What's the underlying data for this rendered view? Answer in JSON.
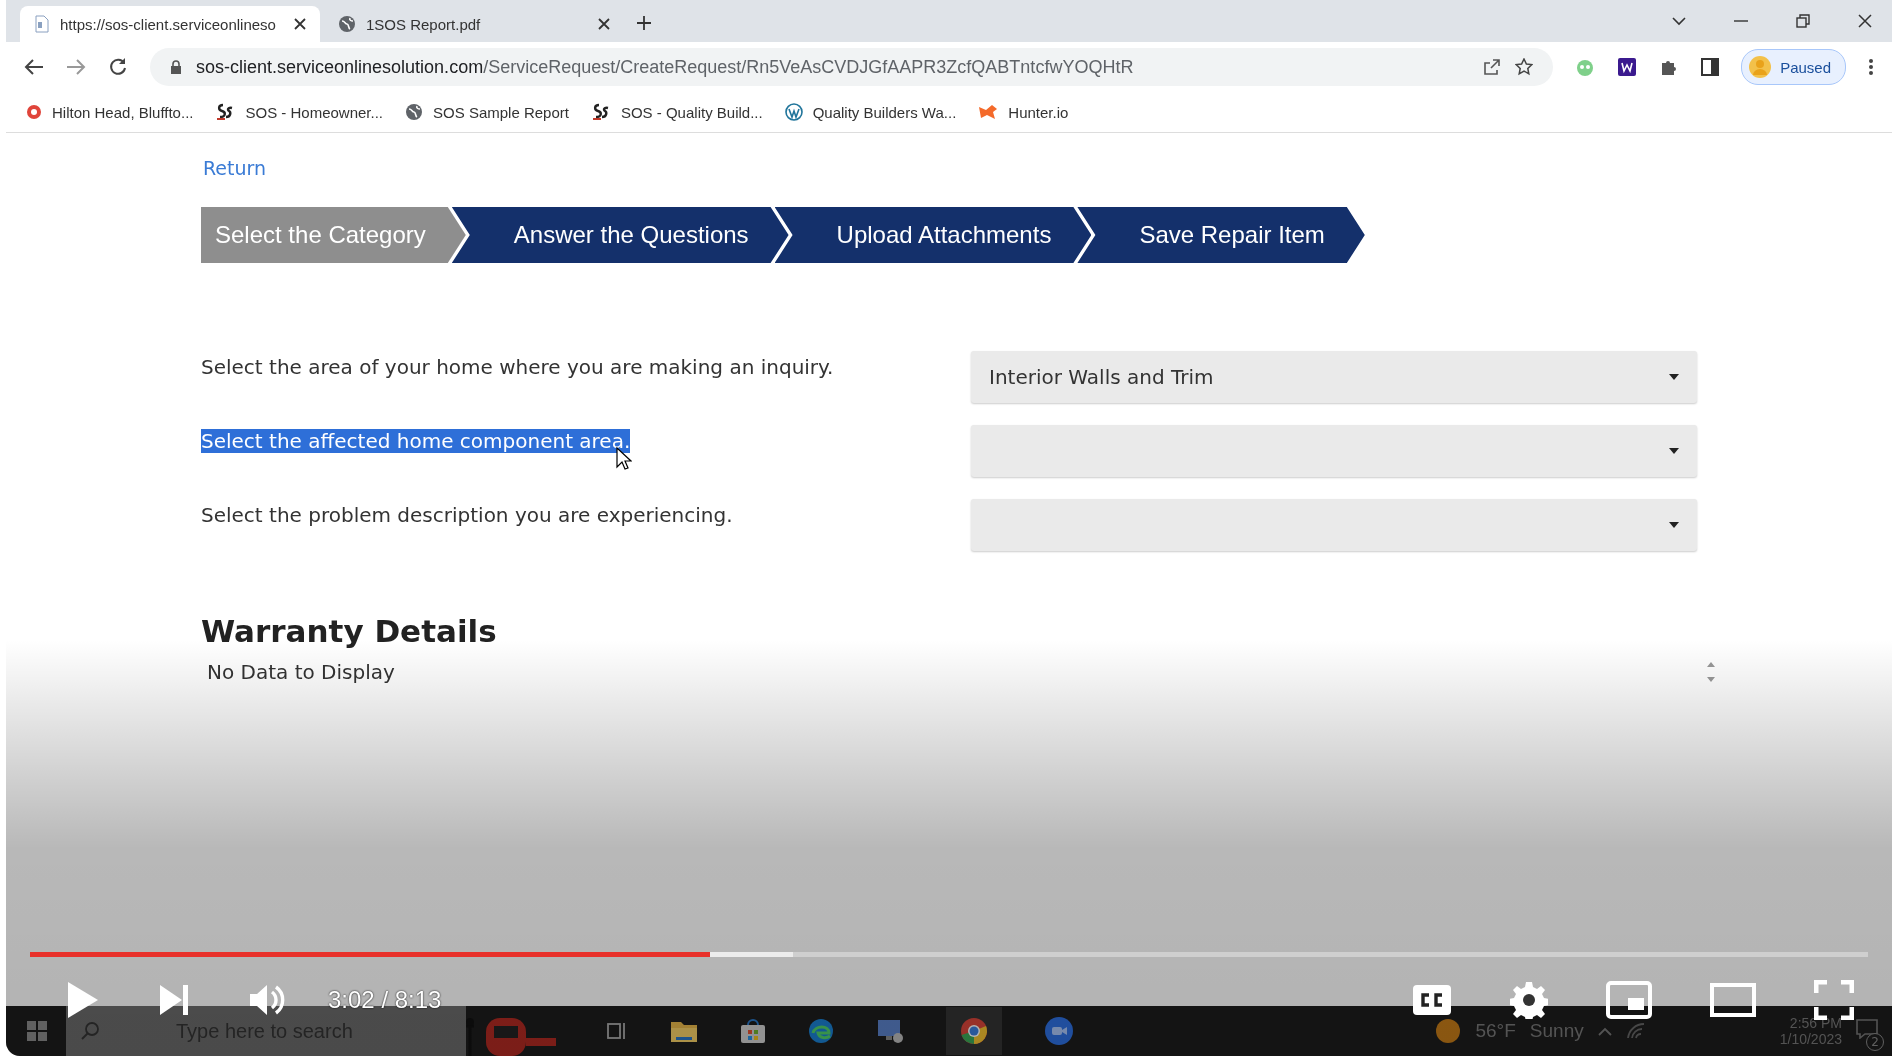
{
  "browser": {
    "tabs": [
      {
        "title": "https://sos-client.serviceonlineso",
        "kind": "page",
        "selected": true
      },
      {
        "title": "1SOS Report.pdf",
        "kind": "globe",
        "selected": false
      }
    ],
    "address": {
      "domain": "sos-client.serviceonlinesolution.com",
      "path": "/ServiceRequest/CreateRequest/Rn5VeAsCVDJGfAAPR3ZcfQABTntcfwYOQHtR"
    },
    "profile": "Paused",
    "bookmarks": [
      {
        "label": "Hilton Head, Bluffto...",
        "kind": "dot"
      },
      {
        "label": "SOS - Homeowner...",
        "kind": "sos"
      },
      {
        "label": "SOS Sample Report",
        "kind": "globe"
      },
      {
        "label": "SOS - Quality Build...",
        "kind": "sos"
      },
      {
        "label": "Quality Builders Wa...",
        "kind": "wp"
      },
      {
        "label": "Hunter.io",
        "kind": "hunter"
      }
    ]
  },
  "page": {
    "return_link": "Return",
    "steps": [
      {
        "label": "Select the Category",
        "selected": true
      },
      {
        "label": "Answer the Questions",
        "selected": false
      },
      {
        "label": "Upload Attachments",
        "selected": false
      },
      {
        "label": "Save Repair Item",
        "selected": false
      }
    ],
    "questions": [
      {
        "label": "Select the area of your home where you are making an inquiry.",
        "highlighted": false,
        "value": "Interior Walls and Trim"
      },
      {
        "label": "Select the affected home component area.",
        "highlighted": true
      },
      {
        "label": "Select the problem description you are experiencing.",
        "highlighted": false
      }
    ],
    "warranty": {
      "title": "Warranty Details",
      "empty": "No Data to Display"
    }
  },
  "taskbar": {
    "search": {
      "placeholder": "Type here to search"
    },
    "temperature": "56°F",
    "weather": "Sunny",
    "clock": "2:56 PM",
    "date": "1/10/2023",
    "notifications": "2"
  },
  "player": {
    "progress": {
      "level": 0.37
    },
    "buffered": {
      "level": 0.415
    },
    "time": "3:02 / 8:13"
  }
}
